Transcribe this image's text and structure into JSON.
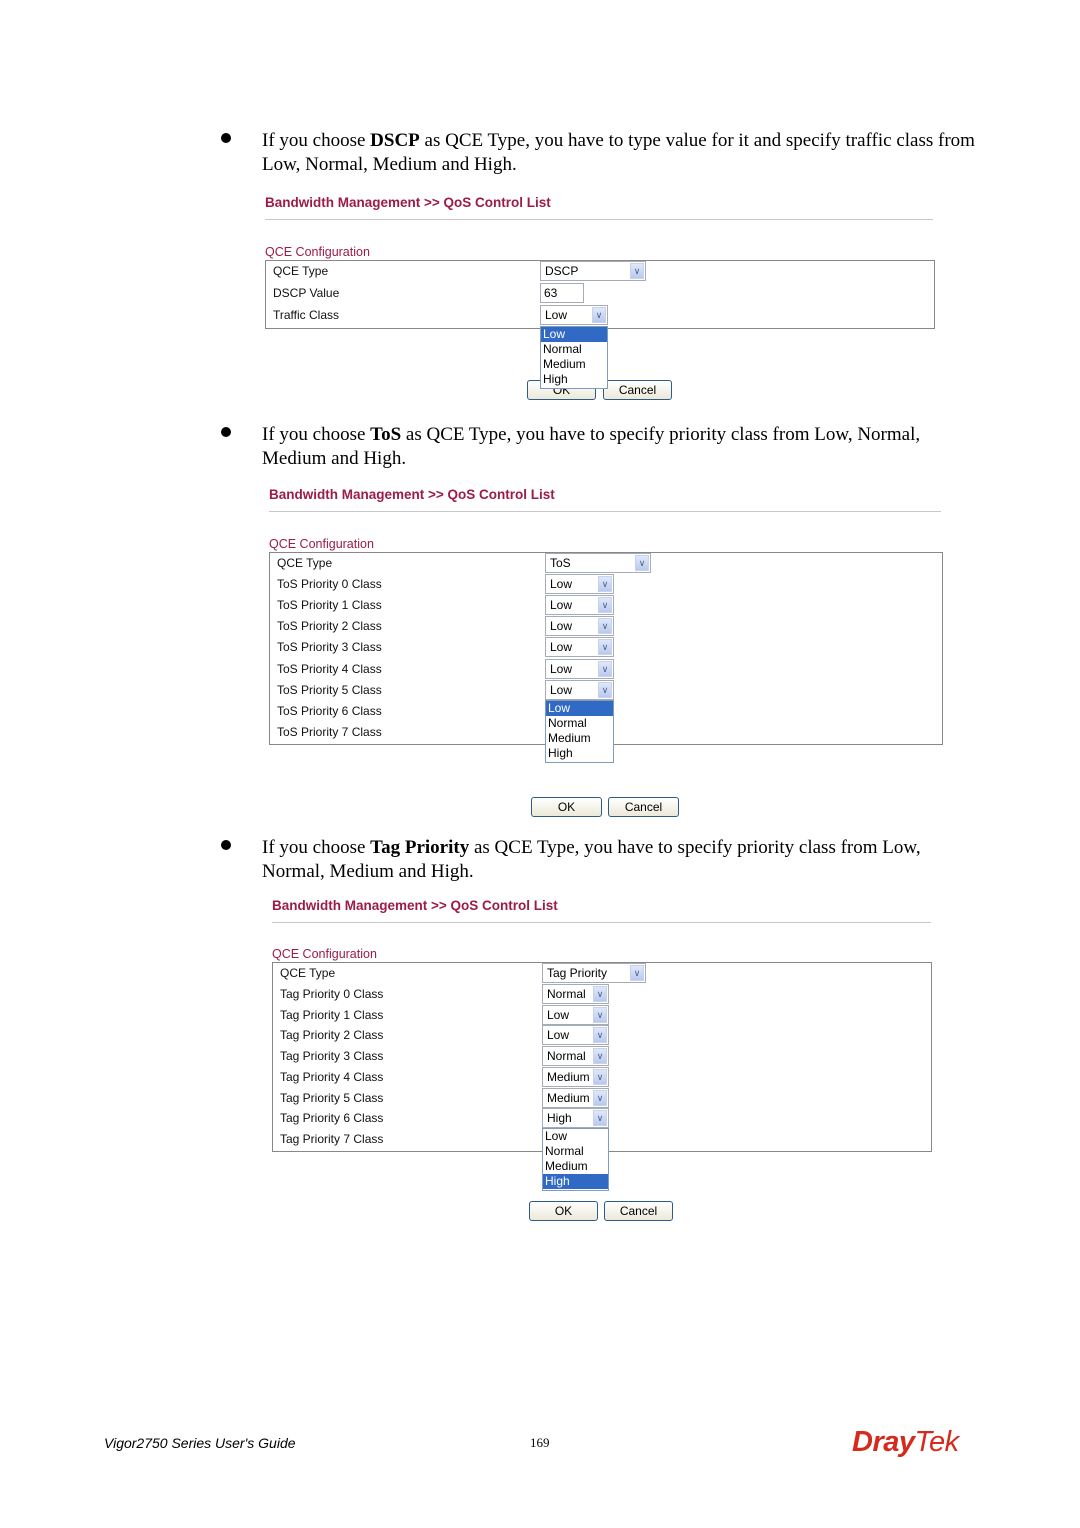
{
  "sections": [
    {
      "text_before": "If you choose ",
      "text_bold": "DSCP",
      "text_after": " as QCE Type, you have to type value for it and specify traffic class from Low, Normal, Medium and High.",
      "breadcrumb": "Bandwidth Management >> QoS Control List",
      "config_title": "QCE Configuration",
      "rows": [
        {
          "label": "QCE Type",
          "kind": "select",
          "value": "DSCP"
        },
        {
          "label": "DSCP Value",
          "kind": "input",
          "value": "63"
        },
        {
          "label": "Traffic Class",
          "kind": "select",
          "value": "Low"
        }
      ],
      "open_dropdown": {
        "row": 2,
        "options": [
          "Low",
          "Normal",
          "Medium",
          "High"
        ],
        "highlighted": "Low"
      },
      "ok_label": "OK",
      "cancel_label": "Cancel"
    },
    {
      "text_before": "If you choose ",
      "text_bold": "ToS",
      "text_after": " as QCE Type, you have to specify priority class from Low, Normal, Medium and High.",
      "breadcrumb": "Bandwidth Management >> QoS Control List",
      "config_title": "QCE Configuration",
      "rows": [
        {
          "label": "QCE Type",
          "kind": "select",
          "value": "ToS"
        },
        {
          "label": "ToS Priority 0 Class",
          "kind": "select",
          "value": "Low"
        },
        {
          "label": "ToS Priority 1 Class",
          "kind": "select",
          "value": "Low"
        },
        {
          "label": "ToS Priority 2 Class",
          "kind": "select",
          "value": "Low"
        },
        {
          "label": "ToS Priority 3 Class",
          "kind": "select",
          "value": "Low"
        },
        {
          "label": "ToS Priority 4 Class",
          "kind": "select",
          "value": "Low"
        },
        {
          "label": "ToS Priority 5 Class",
          "kind": "select",
          "value": "Low"
        },
        {
          "label": "ToS Priority 6 Class",
          "kind": "none",
          "value": ""
        },
        {
          "label": "ToS Priority 7 Class",
          "kind": "none",
          "value": ""
        }
      ],
      "open_dropdown": {
        "row": 6,
        "options": [
          "Low",
          "Normal",
          "Medium",
          "High"
        ],
        "highlighted": "Low"
      },
      "ok_label": "OK",
      "cancel_label": "Cancel"
    },
    {
      "text_before": "If you choose ",
      "text_bold": "Tag Priority",
      "text_after": " as QCE Type, you have to specify priority class from Low, Normal, Medium and High.",
      "breadcrumb": "Bandwidth Management >> QoS Control List",
      "config_title": "QCE Configuration",
      "rows": [
        {
          "label": "QCE Type",
          "kind": "select",
          "value": "Tag Priority"
        },
        {
          "label": "Tag Priority 0 Class",
          "kind": "select",
          "value": "Normal"
        },
        {
          "label": "Tag Priority 1 Class",
          "kind": "select",
          "value": "Low"
        },
        {
          "label": "Tag Priority 2 Class",
          "kind": "select",
          "value": "Low"
        },
        {
          "label": "Tag Priority 3 Class",
          "kind": "select",
          "value": "Normal"
        },
        {
          "label": "Tag Priority 4 Class",
          "kind": "select",
          "value": "Medium"
        },
        {
          "label": "Tag Priority 5 Class",
          "kind": "select",
          "value": "Medium"
        },
        {
          "label": "Tag Priority 6 Class",
          "kind": "select",
          "value": "High"
        },
        {
          "label": "Tag Priority 7 Class",
          "kind": "none",
          "value": ""
        }
      ],
      "open_dropdown": {
        "row": 7,
        "options": [
          "Low",
          "Normal",
          "Medium",
          "High"
        ],
        "highlighted": "High"
      },
      "ok_label": "OK",
      "cancel_label": "Cancel"
    }
  ],
  "footer": {
    "guide_title": "Vigor2750 Series User's Guide",
    "page_number": "169",
    "logo_text": "DrayTek",
    "logo_color": "#d52b1e"
  },
  "colors": {
    "title": "#9c1c45",
    "highlight": "#316ac5"
  }
}
